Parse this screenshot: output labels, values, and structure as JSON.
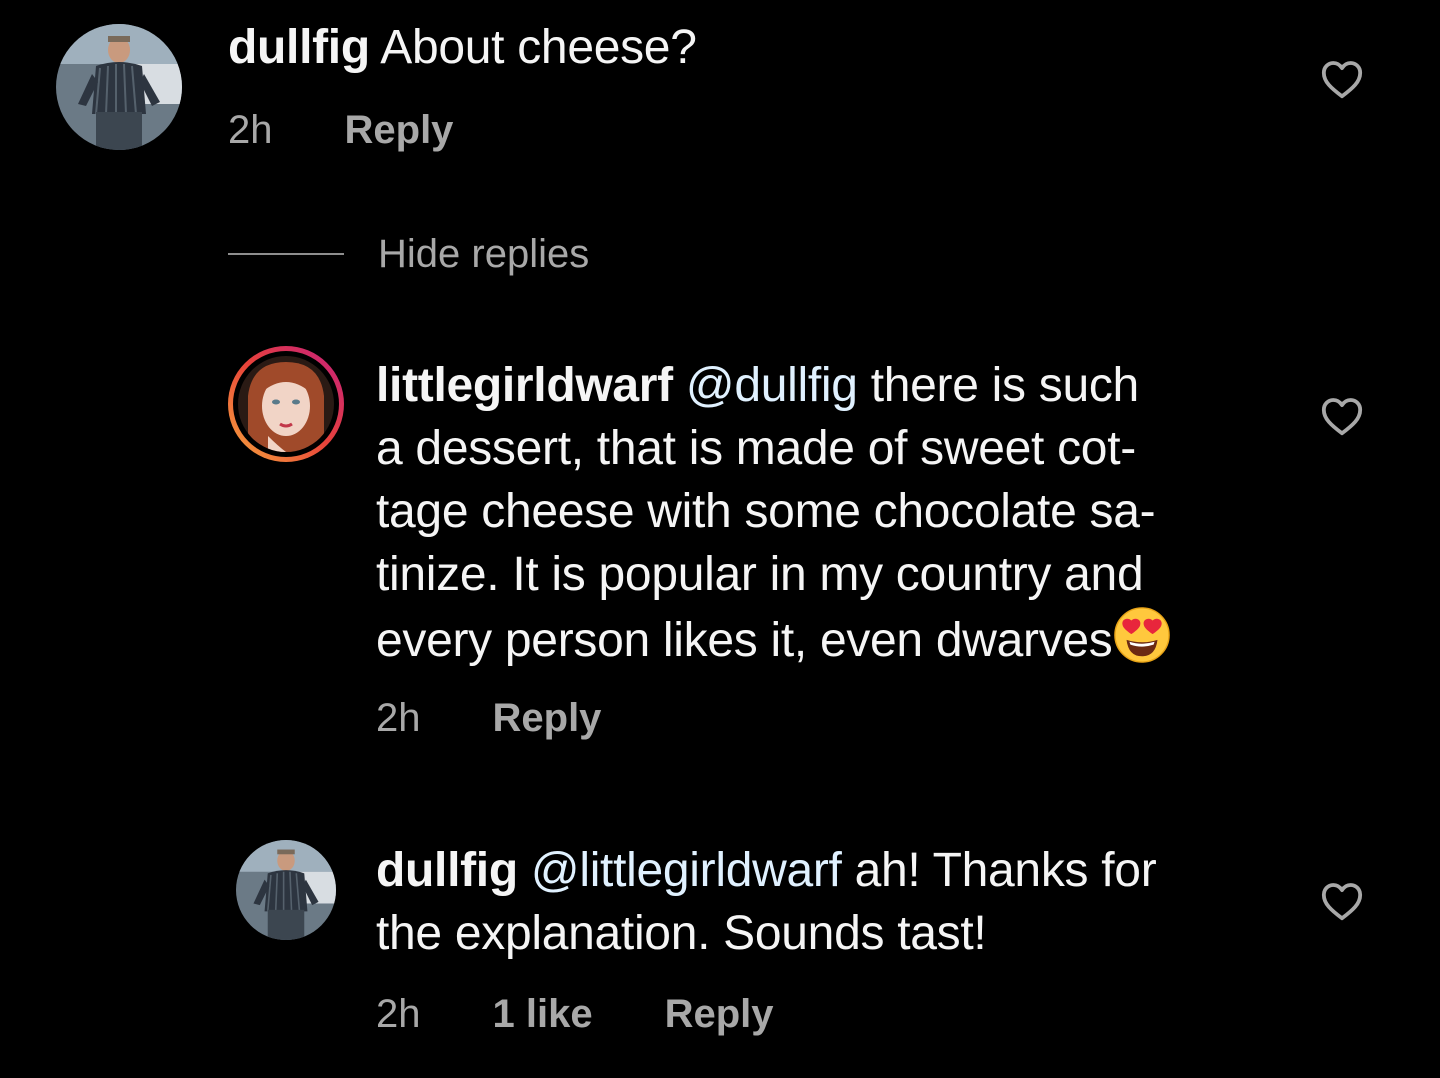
{
  "comments": [
    {
      "username": "dullfig",
      "text": "About cheese?",
      "time": "2h",
      "reply_label": "Reply"
    }
  ],
  "hide_replies_label": "Hide replies",
  "replies": [
    {
      "username": "littlegirldwarf",
      "mention": "@dullfig",
      "lines": [
        "there is such",
        "a dessert, that is made of sweet cot-",
        "tage cheese with some chocolate sa-",
        "tinize. It is popular in my country and",
        "every person likes it, even dwarves"
      ],
      "emoji": "heart-eyes-emoji",
      "time": "2h",
      "reply_label": "Reply"
    },
    {
      "username": "dullfig",
      "mention": "@littlegirldwarf",
      "lines": [
        "ah! Thanks for",
        "the explanation. Sounds tast!"
      ],
      "time": "2h",
      "likes": "1 like",
      "reply_label": "Reply"
    }
  ],
  "icons": {
    "like": "heart-outline-icon"
  },
  "colors": {
    "background": "#000000",
    "text": "#f5f5f5",
    "secondary": "#a8a8a8",
    "mention": "#e0f1ff"
  }
}
